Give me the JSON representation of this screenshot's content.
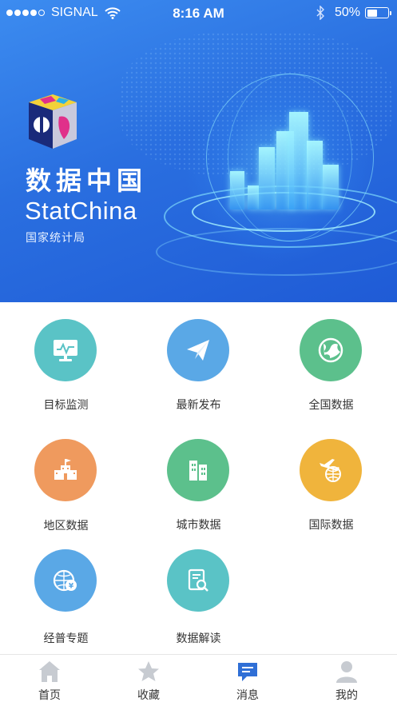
{
  "status_bar": {
    "carrier": "SIGNAL",
    "time": "8:16 AM",
    "battery_text": "50%",
    "battery_level": 0.5
  },
  "banner": {
    "title_cn": "数据中国",
    "title_en": "StatChina",
    "subtitle": "国家统计局"
  },
  "menu": [
    {
      "label": "目标监测",
      "icon": "monitor-chart-icon",
      "color": "#5ac3c6"
    },
    {
      "label": "最新发布",
      "icon": "paper-plane-icon",
      "color": "#5aa8e6"
    },
    {
      "label": "全国数据",
      "icon": "globe-icon",
      "color": "#5cc08c"
    },
    {
      "label": "地区数据",
      "icon": "building-government-icon",
      "color": "#ef9a5e"
    },
    {
      "label": "城市数据",
      "icon": "city-buildings-icon",
      "color": "#5cc08c"
    },
    {
      "label": "国际数据",
      "icon": "airplane-globe-icon",
      "color": "#f0b43c"
    },
    {
      "label": "经普专题",
      "icon": "globe-currency-icon",
      "color": "#5aa8e6"
    },
    {
      "label": "数据解读",
      "icon": "document-search-icon",
      "color": "#5ac3c6"
    }
  ],
  "tabs": [
    {
      "label": "首页",
      "icon": "home-icon",
      "active": false
    },
    {
      "label": "收藏",
      "icon": "star-icon",
      "active": false
    },
    {
      "label": "消息",
      "icon": "message-icon",
      "active": true
    },
    {
      "label": "我的",
      "icon": "user-icon",
      "active": false
    }
  ],
  "colors": {
    "banner_blue": "#2a6fe0",
    "tab_inactive": "#c7cbd1",
    "tab_active": "#2f6fd6"
  }
}
